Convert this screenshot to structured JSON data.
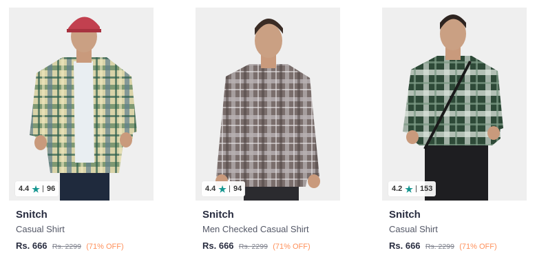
{
  "products": [
    {
      "brand": "Snitch",
      "title": "Casual Shirt",
      "rating": "4.4",
      "reviews": "96",
      "price": "Rs. 666",
      "mrp": "Rs. 2299",
      "discount": "(71% OFF)",
      "image_icon": "model-photo-yellow-green-check-shirt"
    },
    {
      "brand": "Snitch",
      "title": "Men Checked Casual Shirt",
      "rating": "4.4",
      "reviews": "94",
      "price": "Rs. 666",
      "mrp": "Rs. 2299",
      "discount": "(71% OFF)",
      "image_icon": "model-photo-brown-check-shirt"
    },
    {
      "brand": "Snitch",
      "title": "Casual Shirt",
      "rating": "4.2",
      "reviews": "153",
      "price": "Rs. 666",
      "mrp": "Rs. 2299",
      "discount": "(71% OFF)",
      "image_icon": "model-photo-dark-green-check-shirt"
    }
  ],
  "colors": {
    "star": "#14958f",
    "discount": "#ff905a",
    "brand_text": "#282c3f"
  }
}
